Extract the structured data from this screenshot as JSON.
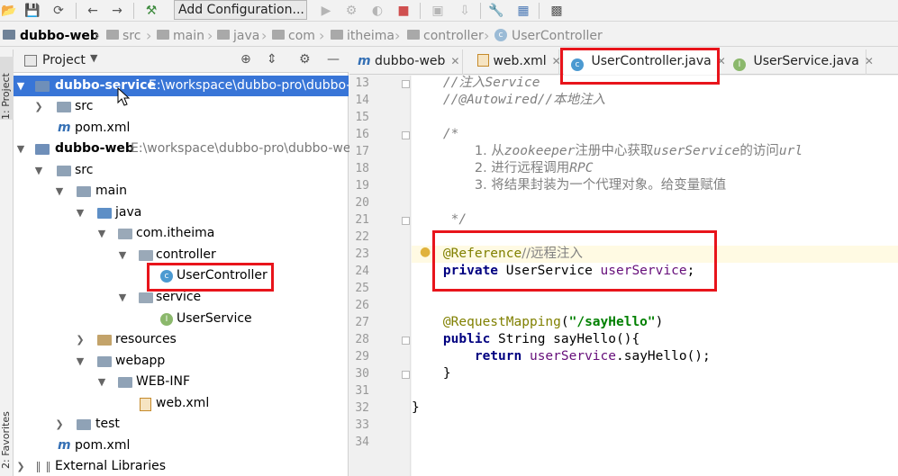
{
  "toolbar": {
    "run_config_label": "Add Configuration...",
    "icons": [
      "open-icon",
      "save-icon",
      "sync-icon",
      "back-icon",
      "forward-icon",
      "build-icon",
      "run-icon",
      "debug-icon",
      "coverage-icon",
      "stop-icon",
      "project-structure-icon",
      "sdk-icon",
      "settings-icon",
      "structure-icon",
      "vcs-icon"
    ]
  },
  "breadcrumb": {
    "items": [
      "dubbo-web",
      "src",
      "main",
      "java",
      "com",
      "itheima",
      "controller",
      "UserController"
    ]
  },
  "left_stripe": {
    "project_tab": "1: Project",
    "favorites_tab": "2: Favorites"
  },
  "project_panel": {
    "title": "Project",
    "tree": [
      {
        "label": "dubbo-service",
        "path": "E:\\workspace\\dubbo-pro\\dubbo-s",
        "selected": true
      },
      {
        "label": "src"
      },
      {
        "label": "pom.xml"
      },
      {
        "label": "dubbo-web",
        "path": "E:\\workspace\\dubbo-pro\\dubbo-we"
      },
      {
        "label": "src"
      },
      {
        "label": "main"
      },
      {
        "label": "java"
      },
      {
        "label": "com.itheima"
      },
      {
        "label": "controller"
      },
      {
        "label": "UserController"
      },
      {
        "label": "service"
      },
      {
        "label": "UserService"
      },
      {
        "label": "resources"
      },
      {
        "label": "webapp"
      },
      {
        "label": "WEB-INF"
      },
      {
        "label": "web.xml"
      },
      {
        "label": "test"
      },
      {
        "label": "pom.xml"
      },
      {
        "label": "External Libraries"
      }
    ]
  },
  "editor_tabs": [
    {
      "label": "dubbo-web"
    },
    {
      "label": "web.xml"
    },
    {
      "label": "UserController.java",
      "active": true
    },
    {
      "label": "UserService.java"
    }
  ],
  "editor": {
    "line_numbers": [
      "13",
      "14",
      "15",
      "16",
      "17",
      "18",
      "19",
      "20",
      "21",
      "22",
      "23",
      "24",
      "25",
      "26",
      "27",
      "28",
      "29",
      "30",
      "31",
      "32",
      "33",
      "34"
    ],
    "lines": {
      "l13": "//注入Service",
      "l14a": "//@Autowired",
      "l14b": "//本地注入",
      "l16": "/*",
      "l17a": "1. 从",
      "l17b": "zookeeper",
      "l17c": "注册中心获取",
      "l17d": "userService",
      "l17e": "的访问",
      "l17f": "url",
      "l18a": "2. 进行远程调用",
      "l18b": "RPC",
      "l19": "3. 将结果封装为一个代理对象。给变量赋值",
      "l21": "*/",
      "l23a": "@Reference",
      "l23b": "//远程注入",
      "l24a": "private",
      "l24b": "UserService",
      "l24c": "userService",
      "l24d": ";",
      "l27a": "@RequestMapping",
      "l27b": "\"/sayHello\"",
      "l28a": "public",
      "l28b": "String sayHello(){",
      "l29a": "return",
      "l29b": "userService",
      "l29c": ".sayHello();",
      "l30": "}",
      "l32": "}"
    }
  },
  "colors": {
    "highlight_box": "#e8141b",
    "selection": "#3875d7",
    "annotation": "#808000",
    "keyword": "#000080",
    "field": "#660e7a",
    "string": "#008000"
  }
}
